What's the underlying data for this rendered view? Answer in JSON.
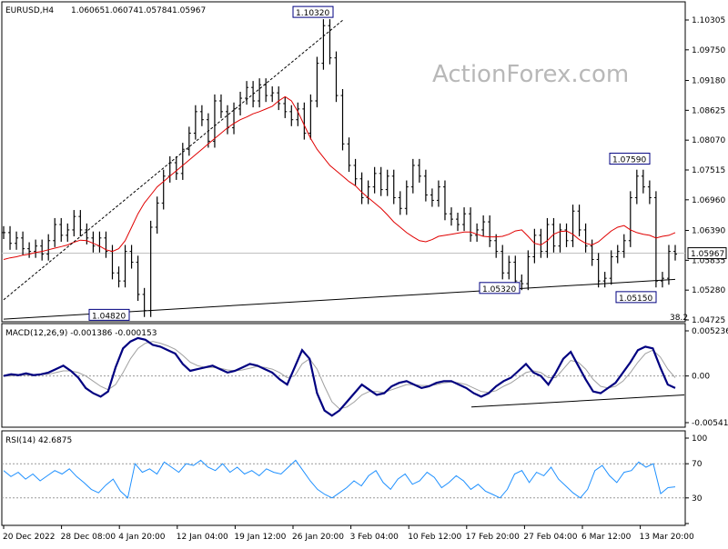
{
  "header": {
    "symbol": "EURUSD,H4",
    "open": "1.06065",
    "high": "1.06074",
    "low": "1.05784",
    "close": "1.05967"
  },
  "watermark": "ActionForex.com",
  "colors": {
    "price_bars": "#000000",
    "moving_average": "#e00000",
    "macd_line": "#000080",
    "macd_signal": "#a0a0a0",
    "rsi_line": "#1e90ff",
    "trendline": "#000000",
    "callout_border": "#000080"
  },
  "chart_data": [
    {
      "type": "line",
      "name": "price",
      "x_labels": [
        "20 Dec 2022",
        "28 Dec 08:00",
        "4 Jan 20:00",
        "12 Jan 04:00",
        "19 Jan 12:00",
        "26 Jan 20:00",
        "3 Feb 04:00",
        "10 Feb 12:00",
        "17 Feb 20:00",
        "27 Feb 04:00",
        "6 Mar 12:00",
        "13 Mar 20:00"
      ],
      "y_ticks": [
        "1.10305",
        "1.09750",
        "1.09180",
        "1.08625",
        "1.08070",
        "1.07515",
        "1.06960",
        "1.06390",
        "1.05835",
        "1.05280",
        "1.04725"
      ],
      "ylim": [
        1.04725,
        1.10305
      ],
      "current_price": "1.05967",
      "fib_label": "38.2",
      "annotations": [
        {
          "label": "1.10320",
          "value": 1.1032
        },
        {
          "label": "1.04820",
          "value": 1.0482
        },
        {
          "label": "1.07590",
          "value": 1.0759
        },
        {
          "label": "1.05320",
          "value": 1.0532
        },
        {
          "label": "1.05150",
          "value": 1.0515
        }
      ],
      "close": [
        1.0635,
        1.0615,
        1.0625,
        1.0605,
        1.06,
        1.061,
        1.0595,
        1.062,
        1.065,
        1.063,
        1.064,
        1.0665,
        1.064,
        1.0625,
        1.061,
        1.0625,
        1.06,
        1.056,
        1.0545,
        1.06,
        1.058,
        1.052,
        1.049,
        1.0645,
        1.069,
        1.074,
        1.0765,
        1.0745,
        1.079,
        1.082,
        1.086,
        1.0845,
        1.0805,
        1.088,
        1.086,
        1.083,
        1.0865,
        1.0885,
        1.0905,
        1.088,
        1.091,
        1.089,
        1.0895,
        1.0875,
        1.086,
        1.0845,
        1.0865,
        1.082,
        1.088,
        1.095,
        1.102,
        1.096,
        1.089,
        1.08,
        1.076,
        1.0735,
        1.07,
        1.072,
        1.0745,
        1.0715,
        1.074,
        1.07,
        1.068,
        1.072,
        1.076,
        1.074,
        1.0705,
        1.0695,
        1.072,
        1.067,
        1.066,
        1.065,
        1.067,
        1.063,
        1.064,
        1.0655,
        1.062,
        1.06,
        1.056,
        1.058,
        1.0545,
        1.054,
        1.059,
        1.063,
        1.06,
        1.065,
        1.061,
        1.064,
        1.062,
        1.0675,
        1.064,
        1.061,
        1.0585,
        1.0545,
        1.055,
        1.059,
        1.06,
        1.062,
        1.07,
        1.074,
        1.072,
        1.07,
        1.0545,
        1.055,
        1.06,
        1.0595
      ],
      "ma": [
        1.0585,
        1.0588,
        1.059,
        1.0593,
        1.0595,
        1.0598,
        1.06,
        1.0603,
        1.0606,
        1.0609,
        1.0612,
        1.0617,
        1.0621,
        1.062,
        1.0615,
        1.061,
        1.0603,
        1.06,
        1.0605,
        1.062,
        1.0645,
        1.067,
        1.069,
        1.0705,
        1.072,
        1.073,
        1.074,
        1.075,
        1.076,
        1.077,
        1.078,
        1.079,
        1.08,
        1.081,
        1.082,
        1.083,
        1.0838,
        1.0845,
        1.085,
        1.0856,
        1.086,
        1.0865,
        1.087,
        1.088,
        1.0888,
        1.088,
        1.086,
        1.0835,
        1.081,
        1.079,
        1.0775,
        1.076,
        1.075,
        1.074,
        1.073,
        1.0722,
        1.071,
        1.07,
        1.069,
        1.068,
        1.0668,
        1.0655,
        1.0645,
        1.0635,
        1.0627,
        1.062,
        1.0618,
        1.0622,
        1.0628,
        1.063,
        1.0632,
        1.0634,
        1.0636,
        1.0636,
        1.0632,
        1.0628,
        1.0627,
        1.0627,
        1.0628,
        1.0632,
        1.0638,
        1.064,
        1.0628,
        1.0615,
        1.0612,
        1.062,
        1.0632,
        1.0637,
        1.0638,
        1.0632,
        1.0622,
        1.0615,
        1.0612,
        1.0618,
        1.0628,
        1.0638,
        1.0645,
        1.0648,
        1.064,
        1.0635,
        1.0632,
        1.063,
        1.0625,
        1.0628,
        1.063,
        1.0635
      ]
    },
    {
      "type": "line",
      "name": "macd",
      "label": "MACD(12,26,9) -0.001386 -0.000153",
      "y_ticks": [
        "0.005236",
        "0.00",
        "-0.005416"
      ],
      "ylim": [
        -0.005416,
        0.005236
      ],
      "macd": [
        0.0,
        0.0002,
        0.0001,
        0.0003,
        0.0001,
        0.0002,
        0.0004,
        0.0008,
        0.0012,
        0.0006,
        -0.0002,
        -0.0014,
        -0.002,
        -0.0024,
        -0.0018,
        0.001,
        0.0032,
        0.004,
        0.0044,
        0.0042,
        0.0036,
        0.0034,
        0.003,
        0.0026,
        0.0014,
        0.0006,
        0.0008,
        0.001,
        0.0012,
        0.0008,
        0.0004,
        0.0006,
        0.001,
        0.0014,
        0.0012,
        0.0008,
        0.0004,
        -0.0004,
        -0.001,
        0.001,
        0.003,
        0.002,
        -0.002,
        -0.004,
        -0.0046,
        -0.004,
        -0.003,
        -0.002,
        -0.001,
        -0.0016,
        -0.0022,
        -0.002,
        -0.0012,
        -0.0008,
        -0.0006,
        -0.001,
        -0.0014,
        -0.0012,
        -0.0008,
        -0.0006,
        -0.0006,
        -0.001,
        -0.0014,
        -0.002,
        -0.0024,
        -0.002,
        -0.0012,
        -0.0006,
        -0.0002,
        0.0006,
        0.0014,
        0.0004,
        0.0,
        -0.001,
        0.0004,
        0.002,
        0.0028,
        0.0012,
        -0.0004,
        -0.0018,
        -0.002,
        -0.0014,
        -0.0008,
        0.0004,
        0.0016,
        0.003,
        0.0034,
        0.0032,
        0.001,
        -0.001,
        -0.0014
      ],
      "signal": [
        0.0,
        0.0,
        0.0001,
        0.0001,
        0.0001,
        0.0002,
        0.0002,
        0.0004,
        0.0006,
        0.0006,
        0.0004,
        0.0,
        -0.0006,
        -0.0012,
        -0.0016,
        -0.001,
        0.0004,
        0.002,
        0.0032,
        0.0038,
        0.004,
        0.0038,
        0.0035,
        0.0031,
        0.0024,
        0.0016,
        0.0012,
        0.001,
        0.001,
        0.0009,
        0.0007,
        0.0006,
        0.0007,
        0.0009,
        0.0011,
        0.001,
        0.0008,
        0.0004,
        -0.0002,
        0.0,
        0.0014,
        0.002,
        0.0008,
        -0.0012,
        -0.003,
        -0.0038,
        -0.0036,
        -0.003,
        -0.0022,
        -0.0018,
        -0.0018,
        -0.0019,
        -0.0016,
        -0.0013,
        -0.001,
        -0.001,
        -0.0011,
        -0.0011,
        -0.001,
        -0.0008,
        -0.0007,
        -0.0008,
        -0.001,
        -0.0014,
        -0.0018,
        -0.0019,
        -0.0017,
        -0.0012,
        -0.0008,
        -0.0002,
        0.0004,
        0.0006,
        0.0004,
        -0.0002,
        -0.0002,
        0.0008,
        0.0018,
        0.0016,
        0.0008,
        -0.0004,
        -0.0012,
        -0.0014,
        -0.0012,
        -0.0006,
        0.0004,
        0.0016,
        0.0026,
        0.003,
        0.0022,
        0.0008,
        -0.0002
      ]
    },
    {
      "type": "line",
      "name": "rsi",
      "label": "RSI(14) 42.6875",
      "y_ticks": [
        "100",
        "70",
        "30",
        "0"
      ],
      "ylim": [
        0,
        100
      ],
      "levels": [
        70,
        30
      ],
      "values": [
        62,
        55,
        60,
        52,
        58,
        50,
        56,
        62,
        58,
        64,
        55,
        48,
        40,
        36,
        45,
        52,
        38,
        30,
        70,
        60,
        64,
        58,
        72,
        66,
        60,
        70,
        68,
        74,
        66,
        62,
        70,
        60,
        66,
        58,
        62,
        56,
        64,
        60,
        58,
        66,
        74,
        62,
        50,
        40,
        34,
        30,
        36,
        42,
        50,
        44,
        56,
        62,
        48,
        40,
        52,
        58,
        46,
        50,
        60,
        54,
        42,
        48,
        56,
        50,
        40,
        46,
        38,
        34,
        30,
        40,
        58,
        62,
        48,
        60,
        56,
        66,
        52,
        44,
        36,
        30,
        40,
        62,
        68,
        56,
        48,
        60,
        62,
        72,
        66,
        70,
        35,
        42,
        43
      ]
    }
  ]
}
